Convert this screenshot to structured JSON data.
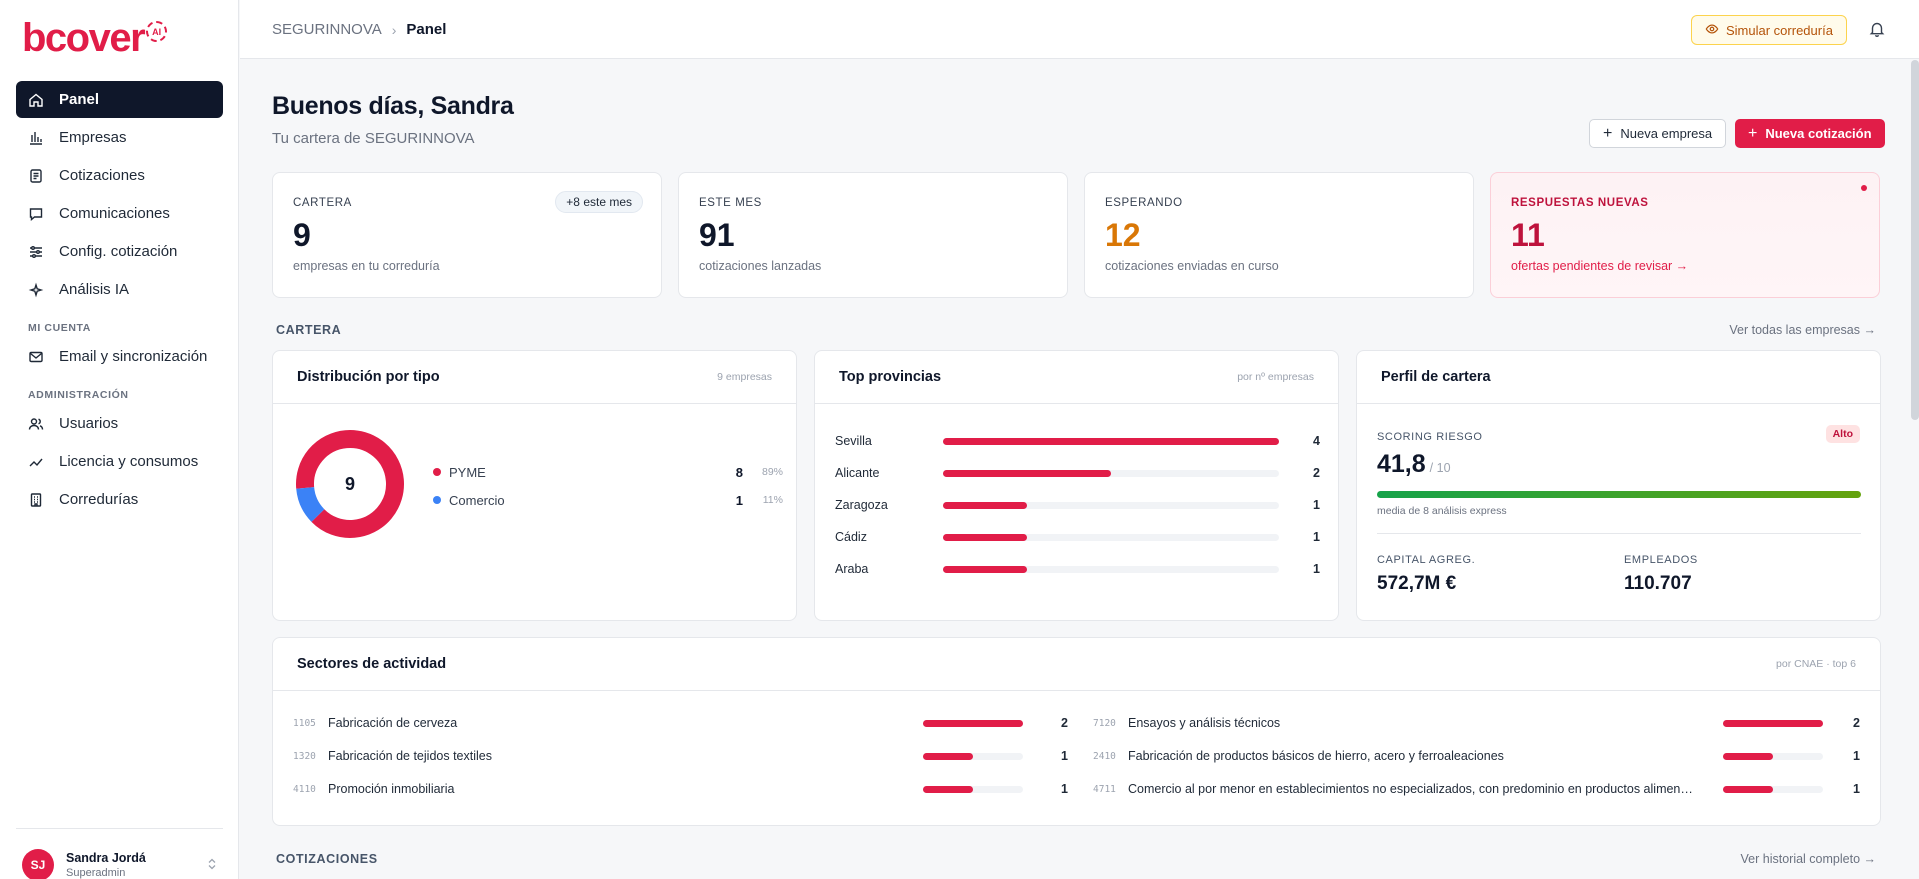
{
  "brand": {
    "name": "bcover",
    "badge": "AI"
  },
  "sidebar": {
    "items": [
      {
        "label": "Panel",
        "icon": "home-icon",
        "active": true
      },
      {
        "label": "Empresas",
        "icon": "bar-chart-icon"
      },
      {
        "label": "Cotizaciones",
        "icon": "documents-icon"
      },
      {
        "label": "Comunicaciones",
        "icon": "chat-icon"
      },
      {
        "label": "Config. cotización",
        "icon": "sliders-icon"
      },
      {
        "label": "Análisis IA",
        "icon": "sparkle-icon"
      }
    ],
    "section_account": "MI CUENTA",
    "account_items": [
      {
        "label": "Email y sincronización",
        "icon": "mail-icon"
      }
    ],
    "section_admin": "ADMINISTRACIÓN",
    "admin_items": [
      {
        "label": "Usuarios",
        "icon": "users-icon"
      },
      {
        "label": "Licencia y consumos",
        "icon": "chart-icon"
      },
      {
        "label": "Corredurías",
        "icon": "building-icon"
      }
    ],
    "user": {
      "initials": "SJ",
      "name": "Sandra Jordá",
      "role": "Superadmin"
    }
  },
  "topbar": {
    "breadcrumb_root": "SEGURINNOVA",
    "breadcrumb_current": "Panel",
    "simulate_label": "Simular correduría"
  },
  "header": {
    "greeting": "Buenos días, Sandra",
    "subtitle": "Tu cartera de SEGURINNOVA",
    "new_company_label": "Nueva empresa",
    "new_quote_label": "Nueva cotización"
  },
  "kpis": [
    {
      "label": "CARTERA",
      "value": "9",
      "desc": "empresas en tu correduría",
      "chip": "+8 este mes"
    },
    {
      "label": "ESTE MES",
      "value": "91",
      "desc": "cotizaciones lanzadas"
    },
    {
      "label": "ESPERANDO",
      "value": "12",
      "desc": "cotizaciones enviadas en curso",
      "color": "#d97706"
    },
    {
      "label": "RESPUESTAS NUEVAS",
      "value": "11",
      "desc": "ofertas pendientes de revisar →"
    }
  ],
  "cartera": {
    "section_title": "CARTERA",
    "section_link": "Ver todas las empresas →",
    "distribution": {
      "title": "Distribución por tipo",
      "meta": "9 empresas",
      "total": "9",
      "items": [
        {
          "label": "PYME",
          "count": 8,
          "pct": "89%",
          "color": "#e11d48"
        },
        {
          "label": "Comercio",
          "count": 1,
          "pct": "11%",
          "color": "#3b82f6"
        }
      ]
    },
    "provinces": {
      "title": "Top provincias",
      "meta": "por nº empresas",
      "max": 4,
      "items": [
        {
          "label": "Sevilla",
          "value": 4
        },
        {
          "label": "Alicante",
          "value": 2
        },
        {
          "label": "Zaragoza",
          "value": 1
        },
        {
          "label": "Cádiz",
          "value": 1
        },
        {
          "label": "Araba",
          "value": 1
        }
      ]
    },
    "profile": {
      "title": "Perfil de cartera",
      "risk_label": "SCORING RIESGO",
      "risk_badge": "Alto",
      "risk_value": "41,8",
      "risk_of": "/ 10",
      "risk_note": "media de 8 análisis express",
      "capital_label": "CAPITAL AGREG.",
      "capital_value": "572,7M €",
      "employees_label": "EMPLEADOS",
      "employees_value": "110.707"
    }
  },
  "sectors": {
    "title": "Sectores de actividad",
    "meta": "por CNAE · top 6",
    "max": 2,
    "left": [
      {
        "code": "1105",
        "name": "Fabricación de cerveza",
        "value": 2
      },
      {
        "code": "1320",
        "name": "Fabricación de tejidos textiles",
        "value": 1
      },
      {
        "code": "4110",
        "name": "Promoción inmobiliaria",
        "value": 1
      }
    ],
    "right": [
      {
        "code": "7120",
        "name": "Ensayos y análisis técnicos",
        "value": 2
      },
      {
        "code": "2410",
        "name": "Fabricación de productos básicos de hierro, acero y ferroaleaciones",
        "value": 1
      },
      {
        "code": "4711",
        "name": "Comercio al por menor en establecimientos no especializados, con predominio en productos alimen…",
        "value": 1
      }
    ]
  },
  "cotizaciones": {
    "section_title": "COTIZACIONES",
    "section_link": "Ver historial completo →"
  }
}
